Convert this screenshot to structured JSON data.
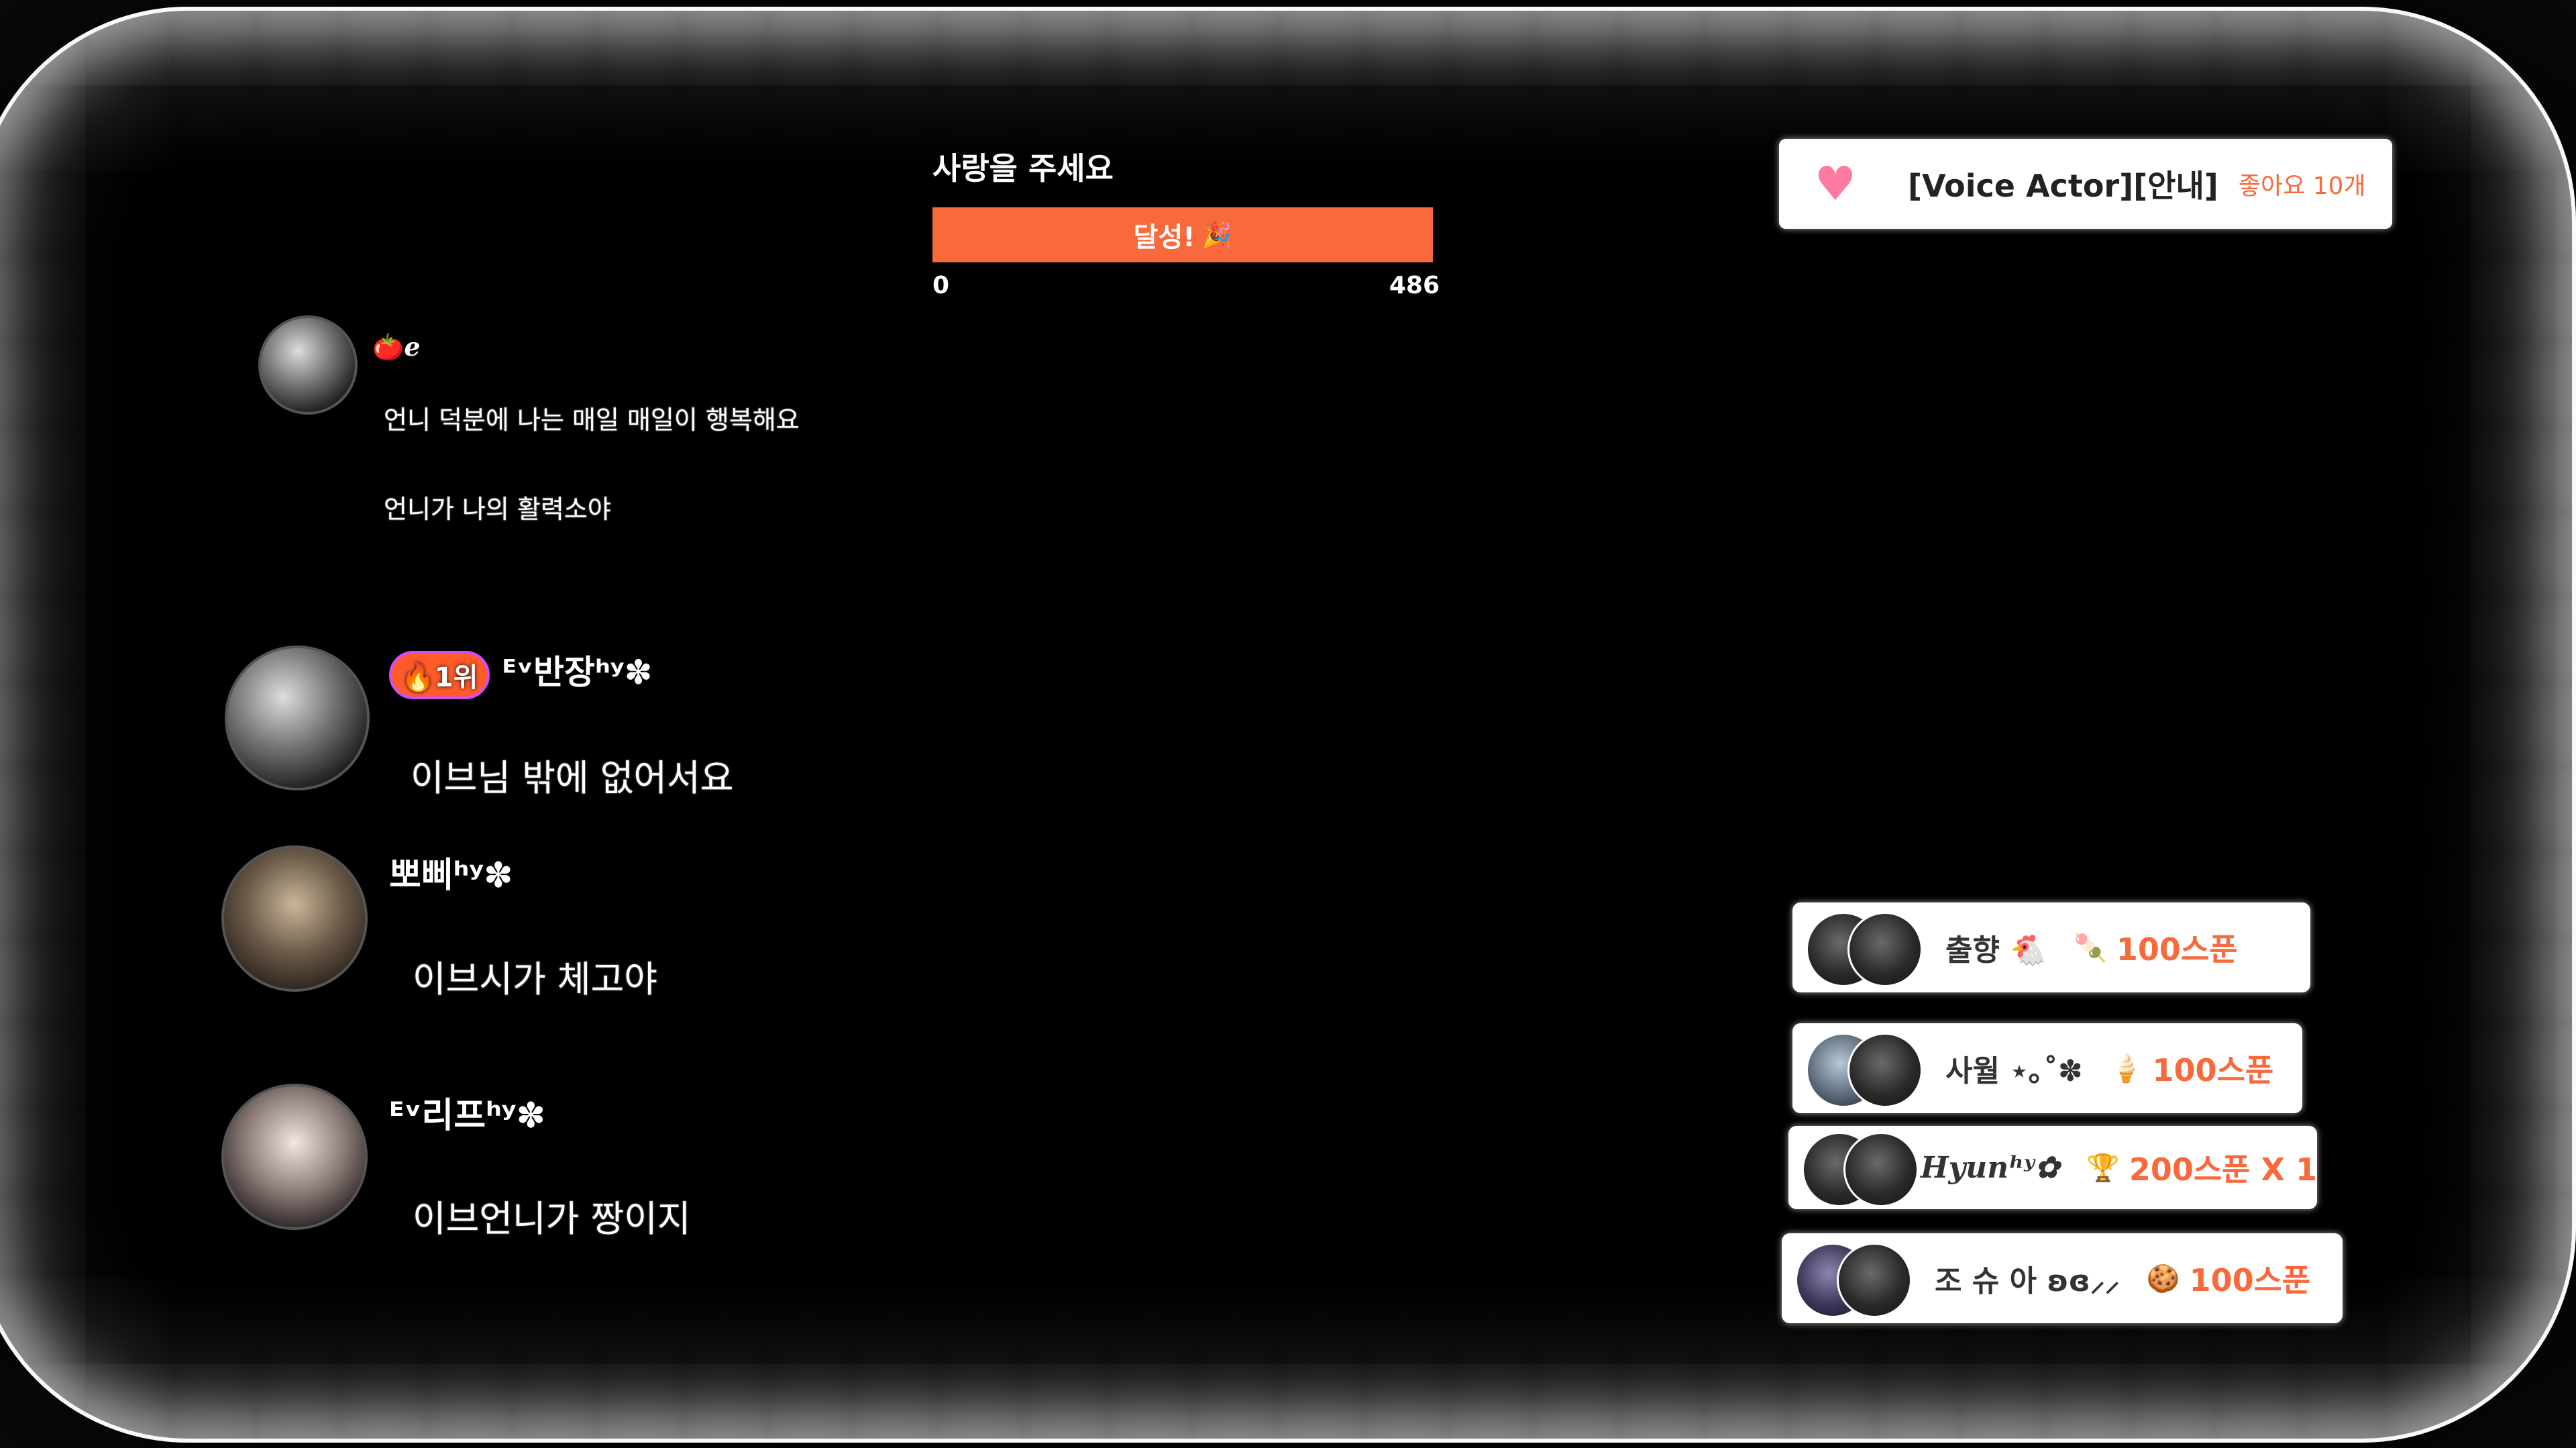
{
  "goal": {
    "title": "사랑을 주세요",
    "status_label": "달성!",
    "status_icon": "🎉",
    "min": "0",
    "max": "486",
    "progress_fraction": 1.0,
    "bar_color": "#f86a3c"
  },
  "chat": [
    {
      "name": "🍅ℯ",
      "lines": [
        "언니 덕분에 나는 매일 매일이 행복해요",
        "언니가 나의 활력소야"
      ]
    },
    {
      "rank": "🔥1위",
      "name": "ᴱᵛ반장ʰʸ✽",
      "lines": [
        "이브님 밖에 없어서요"
      ]
    },
    {
      "name": "뽀삐ʰʸ✽",
      "lines": [
        "이브시가 체고야"
      ]
    },
    {
      "name": "ᴱᵛ리프ʰʸ✽",
      "lines": [
        "이브언니가 짱이지"
      ]
    }
  ],
  "notice": {
    "icon": "heart-icon",
    "title": "[Voice Actor][안내]",
    "likes": "좋아요 10개"
  },
  "donations": [
    {
      "name": "출향 🐔",
      "gift_icon": "🍡",
      "amount": "100스푼"
    },
    {
      "name": "사월 ⋆｡˚✽",
      "gift_icon": "🍦",
      "amount": "100스푼"
    },
    {
      "name": "Hyunʰʸ✿",
      "gift_icon": "🏆",
      "amount": "200스푼 X 1"
    },
    {
      "name": "조 슈 아 ʚɞ⸝⸝",
      "gift_icon": "🍪",
      "amount": "100스푼"
    }
  ],
  "colors": {
    "accent": "#f86a3c",
    "rank_border": "#d04cff"
  }
}
